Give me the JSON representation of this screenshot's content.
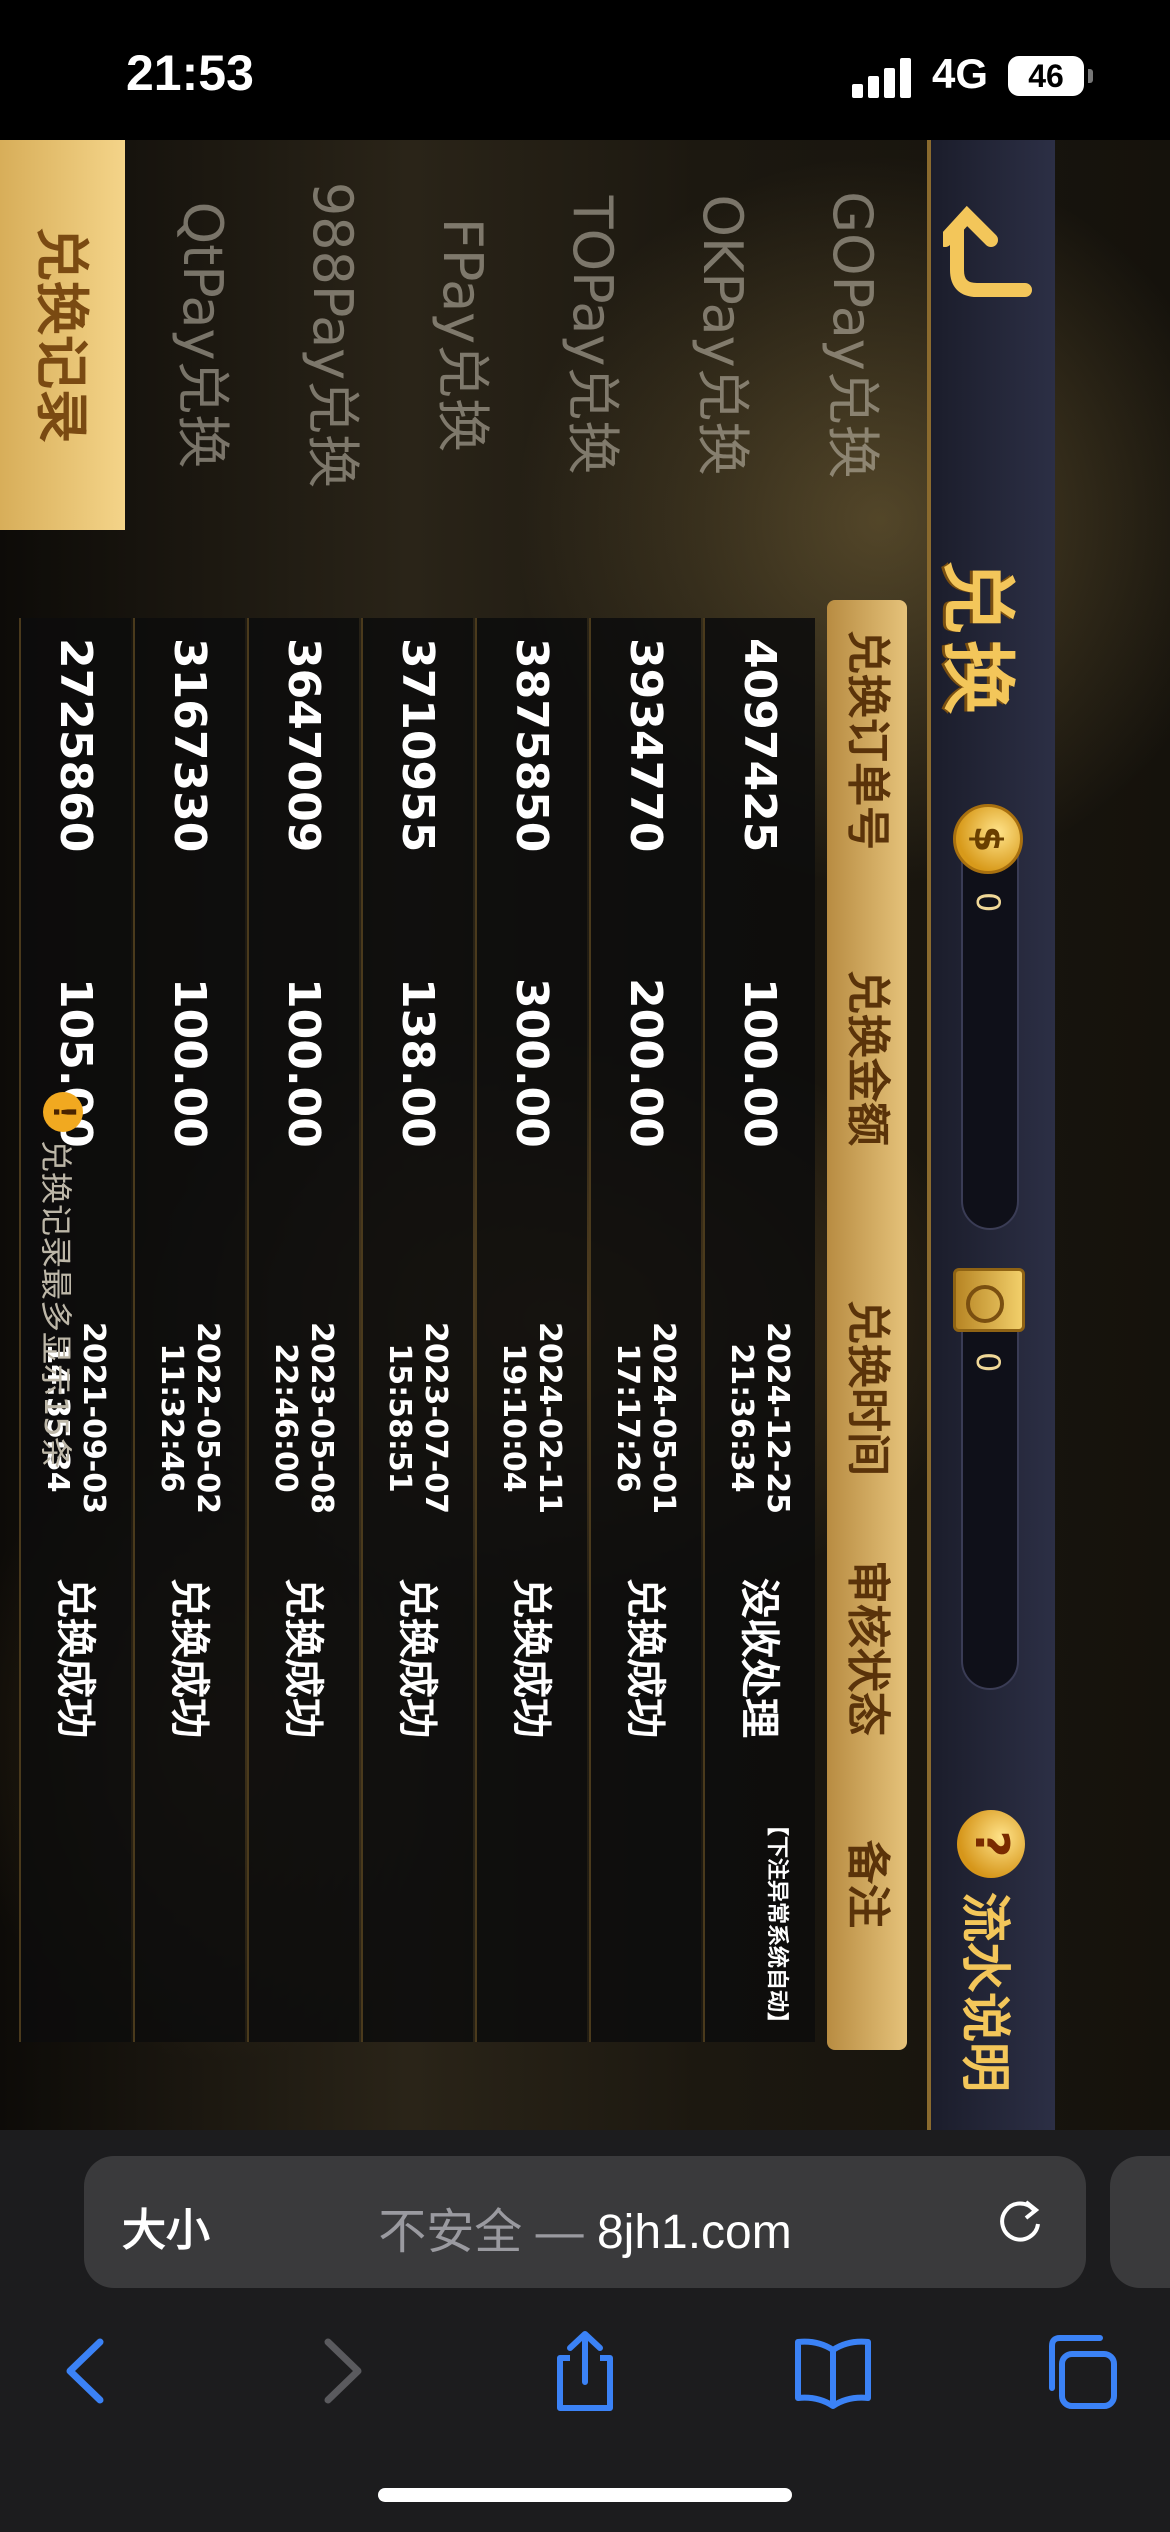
{
  "status_bar": {
    "time": "21:53",
    "network": "4G",
    "battery": "46"
  },
  "header": {
    "title": "兑换",
    "gold_balance": "0",
    "box_balance": "0",
    "help_label": "流水说明",
    "help_symbol": "?",
    "coin_symbol": "$"
  },
  "menu": {
    "items": [
      "GOPay兑换",
      "OKPay兑换",
      "TOPay兑换",
      "FPay兑换",
      "988Pay兑换",
      "QtPay兑换",
      "兑换记录"
    ],
    "active_index": 6
  },
  "table": {
    "headers": [
      "兑换订单号",
      "兑换金额",
      "兑换时间",
      "审核状态",
      "备注"
    ],
    "rows": [
      {
        "id": "4097425",
        "amount": "100.00",
        "date": "2024-12-25",
        "time": "21:36:34",
        "status": "没收处理",
        "note": "【下注异常系统自动】"
      },
      {
        "id": "3934770",
        "amount": "200.00",
        "date": "2024-05-01",
        "time": "17:17:26",
        "status": "兑换成功",
        "note": ""
      },
      {
        "id": "3875850",
        "amount": "300.00",
        "date": "2024-02-11",
        "time": "19:10:04",
        "status": "兑换成功",
        "note": ""
      },
      {
        "id": "3710955",
        "amount": "138.00",
        "date": "2023-07-07",
        "time": "15:58:51",
        "status": "兑换成功",
        "note": ""
      },
      {
        "id": "3647009",
        "amount": "100.00",
        "date": "2023-05-08",
        "time": "22:46:00",
        "status": "兑换成功",
        "note": ""
      },
      {
        "id": "3167330",
        "amount": "100.00",
        "date": "2022-05-02",
        "time": "11:32:46",
        "status": "兑换成功",
        "note": ""
      },
      {
        "id": "2725860",
        "amount": "105.00",
        "date": "2021-09-03",
        "time": "14:35:34",
        "status": "兑换成功",
        "note": ""
      }
    ]
  },
  "notice": {
    "symbol": "!",
    "text": "兑换记录最多显示15条"
  },
  "safari": {
    "text_size_label": "大小",
    "security_label": "不安全 —",
    "domain": "8jh1.com"
  }
}
